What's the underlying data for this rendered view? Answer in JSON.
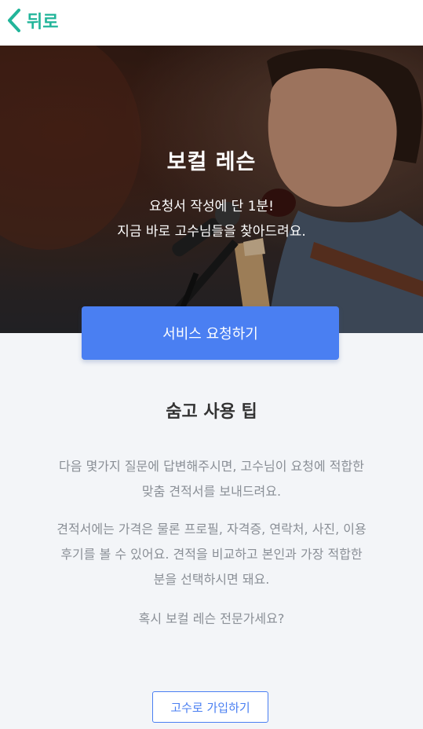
{
  "nav": {
    "back_label": "뒤로"
  },
  "hero": {
    "title": "보컬 레슨",
    "subtitle_line1": "요청서 작성에 단 1분!",
    "subtitle_line2": "지금 바로 고수님들을 찾아드려요."
  },
  "cta": {
    "label": "서비스 요청하기"
  },
  "tips": {
    "title": "숨고 사용 팁",
    "p1_line1": "다음 몇가지 질문에 답변해주시면, 고수님이 요청에 적합한",
    "p1_line2": "맞춤 견적서를 보내드려요.",
    "p2_line1": "견적서에는 가격은 물론 프로필, 자격증, 연락처, 사진, 이용",
    "p2_line2": "후기를 볼 수 있어요. 견적을 비교하고 본인과 가장 적합한",
    "p2_line3": "분을 선택하시면 돼요.",
    "question": "혹시 보컬 레슨 전문가세요?"
  },
  "signup": {
    "label": "고수로 가입하기"
  },
  "colors": {
    "accent_green": "#22b59a",
    "primary_blue": "#4a7ff2",
    "body_text": "#8a8f96",
    "heading_text": "#333333",
    "background": "#f3f5f8"
  },
  "icons": {
    "back": "chevron-left-icon",
    "hero_photo": "singer-photo"
  }
}
